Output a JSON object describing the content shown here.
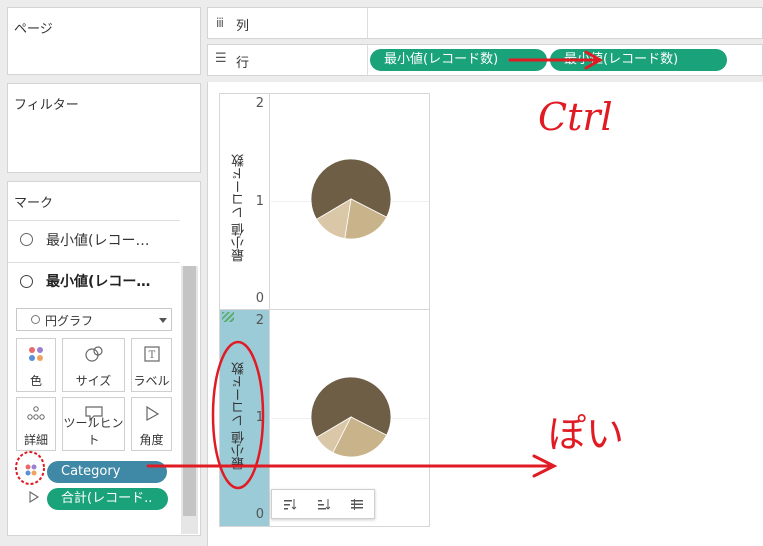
{
  "pages_card": {
    "title": "ページ"
  },
  "filters_card": {
    "title": "フィルター"
  },
  "marks_card": {
    "title": "マーク",
    "sections": [
      {
        "label": "最小値(レコー…",
        "selected": false
      },
      {
        "label": "最小値(レコー…",
        "selected": true
      }
    ],
    "mark_type": "円グラフ",
    "buttons": [
      {
        "label": "色",
        "icon": "color-icon"
      },
      {
        "label": "サイズ",
        "icon": "size-icon"
      },
      {
        "label": "ラベル",
        "icon": "label-icon"
      },
      {
        "label": "詳細",
        "icon": "detail-icon"
      },
      {
        "label": "ツールヒント",
        "icon": "tooltip-icon"
      },
      {
        "label": "角度",
        "icon": "angle-icon"
      }
    ],
    "fields": [
      {
        "label": "Category",
        "icon": "color-dots-icon"
      },
      {
        "label": "合計(レコード..",
        "icon": "angle-icon"
      }
    ]
  },
  "columns_shelf": {
    "label": "列"
  },
  "rows_shelf": {
    "label": "行",
    "pills": [
      "最小値(レコード数)",
      "最小値(レコード数)"
    ]
  },
  "chart_data": [
    {
      "type": "pie",
      "ylabel": "最小値 レコード数",
      "ylim": [
        0,
        2
      ],
      "yticks": [
        "2",
        "1",
        "0"
      ],
      "slices": [
        {
          "value": 0.66,
          "color": "#6e5e45"
        },
        {
          "value": 0.2,
          "color": "#c9b38a"
        },
        {
          "value": 0.14,
          "color": "#d9c7a7"
        }
      ]
    },
    {
      "type": "pie",
      "ylabel": "最小値 レコード数",
      "ylim": [
        0,
        2
      ],
      "yticks": [
        "2",
        "1",
        "0"
      ],
      "slices": [
        {
          "value": 0.66,
          "color": "#6e5e45"
        },
        {
          "value": 0.25,
          "color": "#c9b38a"
        },
        {
          "value": 0.09,
          "color": "#d9c7a7"
        }
      ]
    }
  ],
  "annotations": {
    "ctrl_text": "Ctrl",
    "poi_text": "ぽい"
  },
  "colors": {
    "pill": "#1aa37a",
    "annotation": "#e01b24",
    "highlight_axis": "#9ccbd8"
  }
}
